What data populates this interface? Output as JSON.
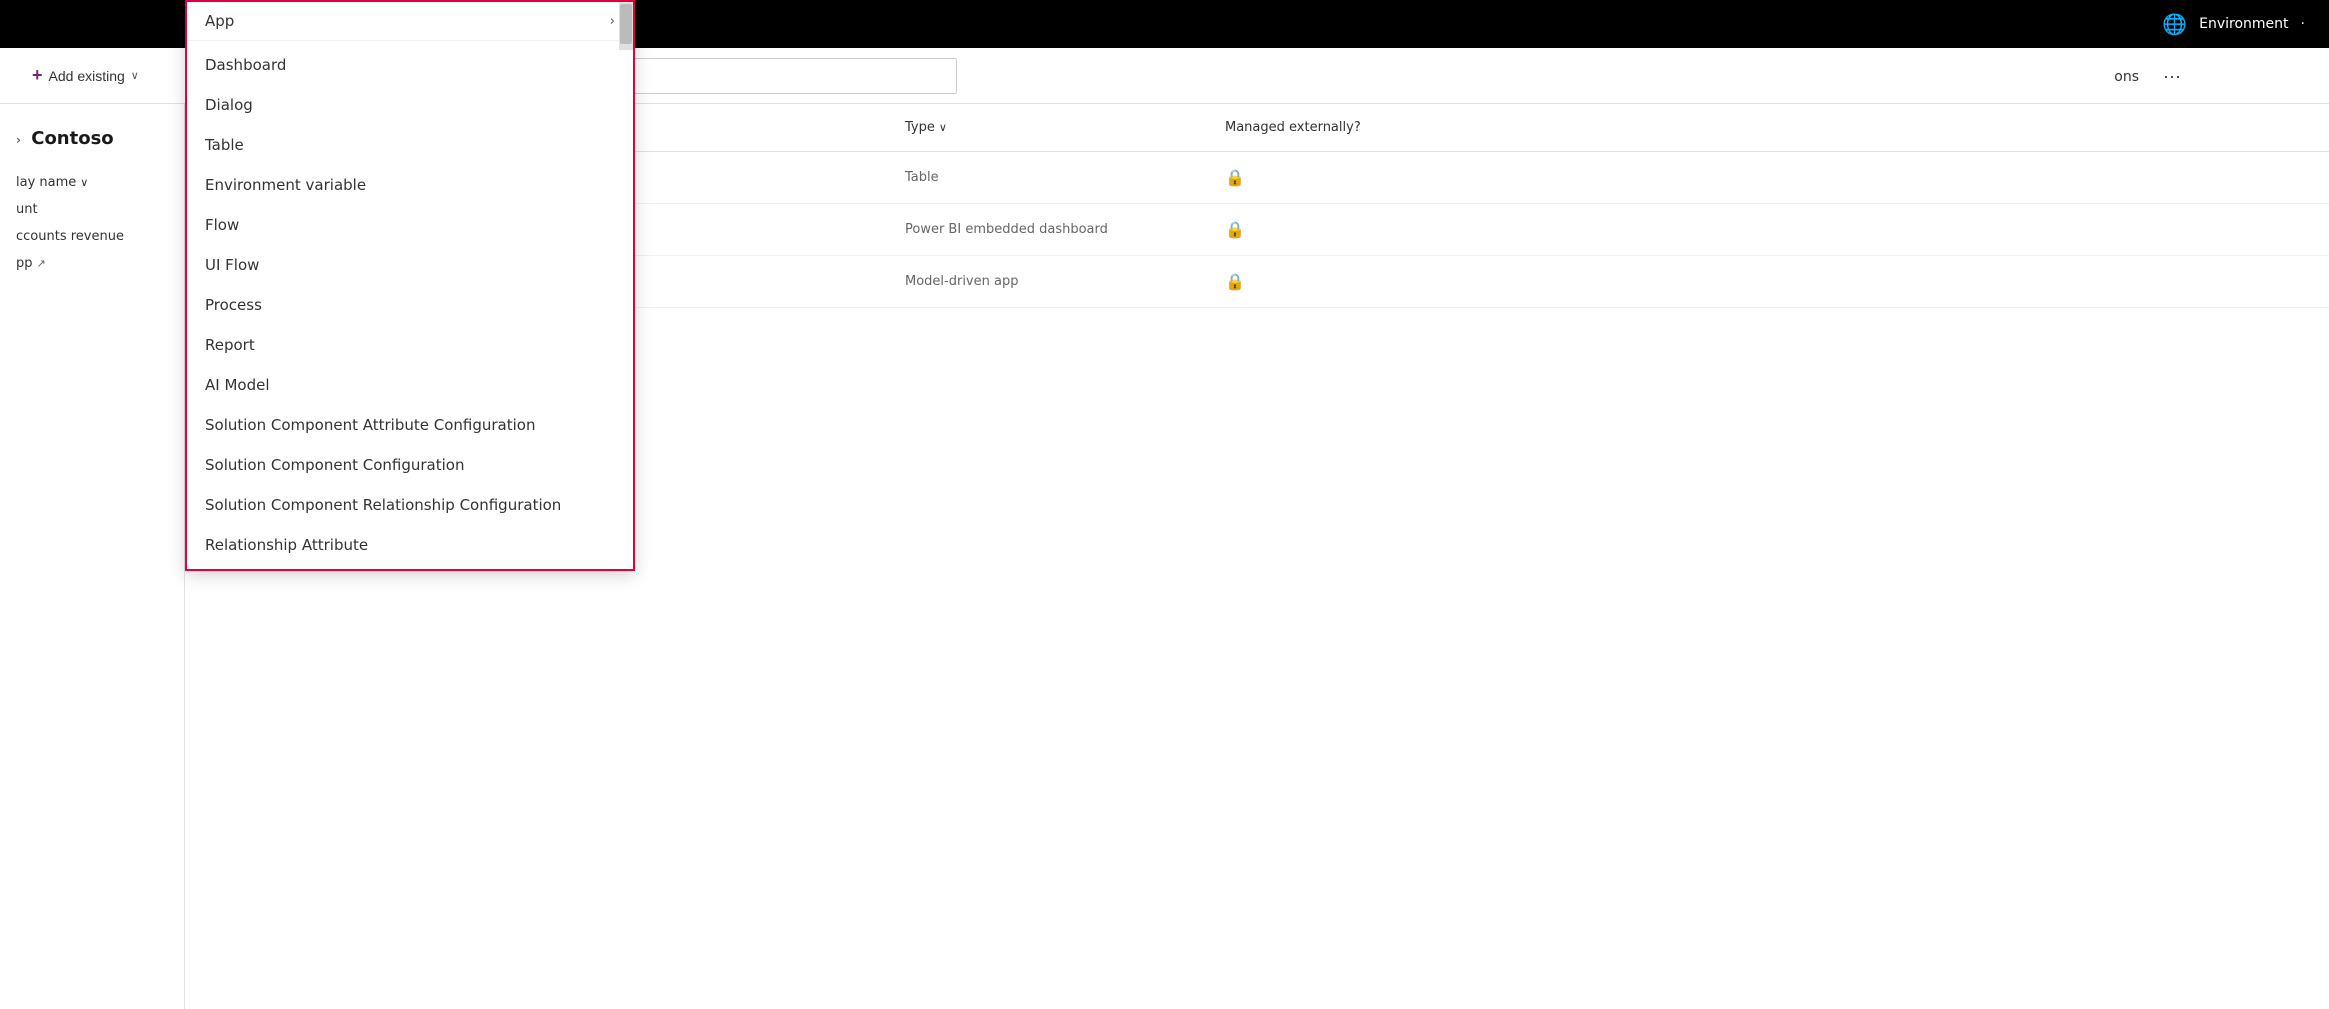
{
  "topBar": {
    "environmentLabel": "Environment",
    "globeIconAlt": "globe-icon"
  },
  "toolbar": {
    "addExistingLabel": "Add existing",
    "searchPlaceholder": "",
    "solutionsLabel": "ons",
    "ellipsisLabel": "···"
  },
  "sidebar": {
    "title": "Contoso",
    "titleChevron": "›",
    "items": [
      {
        "label": "lay name"
      },
      {
        "label": "unt"
      },
      {
        "label": "ccounts revenue"
      },
      {
        "label": "pp"
      }
    ]
  },
  "columnHeaders": {
    "displayName": "lay name",
    "displayNameChevron": "∨",
    "type": "Type",
    "typeChevron": "∨",
    "managedExternally": "Managed externally?"
  },
  "tableRows": [
    {
      "name": "unt",
      "type": "Table",
      "managedExternally": true
    },
    {
      "name": "ccounts revenue",
      "fullName": "ts revenue",
      "type": "Power BI embedded dashboard",
      "managedExternally": true
    },
    {
      "name": "pp",
      "fullName": "pp",
      "type": "Model-driven app",
      "managedExternally": true,
      "hasExtLink": true
    }
  ],
  "dropdown": {
    "appHeader": "App",
    "appChevron": "›",
    "items": [
      {
        "label": "Dashboard"
      },
      {
        "label": "Dialog"
      },
      {
        "label": "Table"
      },
      {
        "label": "Environment variable"
      },
      {
        "label": "Flow"
      },
      {
        "label": "UI Flow"
      },
      {
        "label": "Process"
      },
      {
        "label": "Report"
      },
      {
        "label": "AI Model"
      },
      {
        "label": "Solution Component Attribute Configuration"
      },
      {
        "label": "Solution Component Configuration"
      },
      {
        "label": "Solution Component Relationship Configuration"
      },
      {
        "label": "Relationship Attribute"
      }
    ]
  }
}
